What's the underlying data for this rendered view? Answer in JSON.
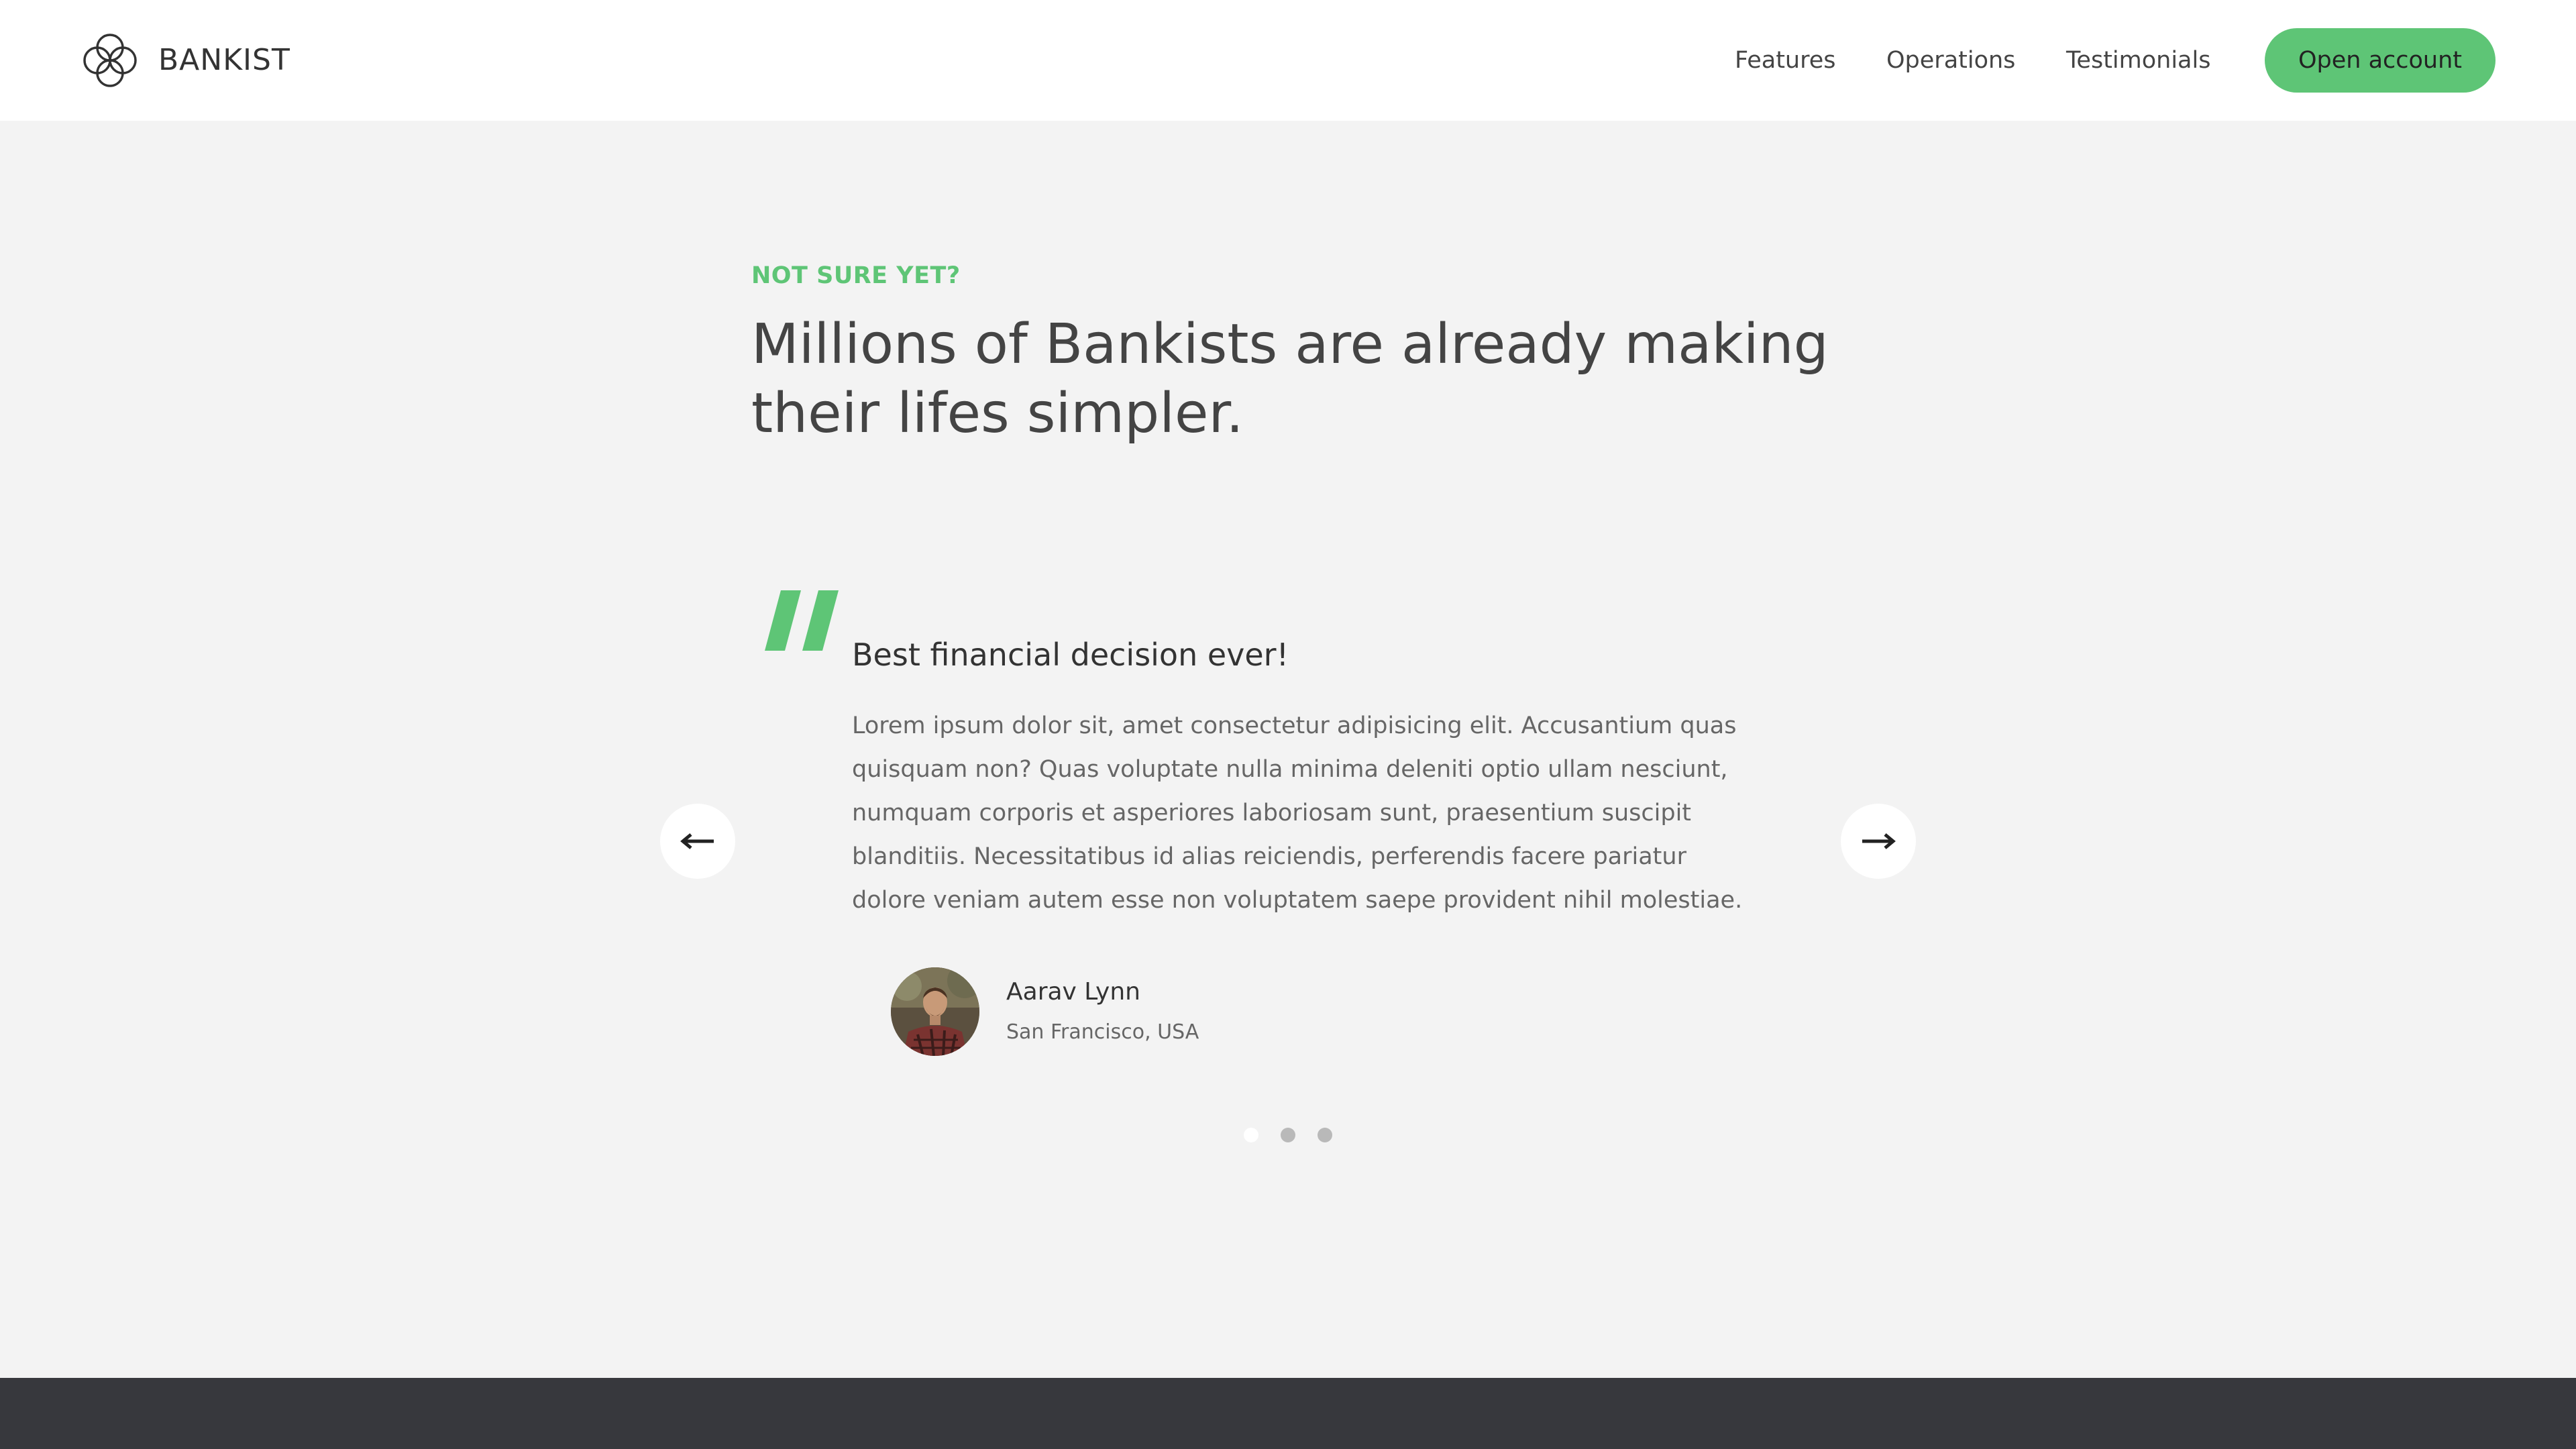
{
  "brand": {
    "name": "BANKIST",
    "logo_icon": "bankist-logo-icon"
  },
  "nav": {
    "links": [
      "Features",
      "Operations",
      "Testimonials"
    ],
    "cta": "Open account"
  },
  "section": {
    "label": "NOT SURE YET?",
    "heading": "Millions of Bankists are already making their lifes simpler."
  },
  "testimonial": {
    "quote_icon": "quote-mark-icon",
    "title": "Best financial decision ever!",
    "text": "Lorem ipsum dolor sit, amet consectetur adipisicing elit. Accusantium quas quisquam non? Quas voluptate nulla minima deleniti optio ullam nesciunt, numquam corporis et asperiores laboriosam sunt, praesentium suscipit blanditiis. Necessitatibus id alias reiciendis, perferendis facere pariatur dolore veniam autem esse non voluptatem saepe provident nihil molestiae.",
    "author": {
      "name": "Aarav Lynn",
      "location": "San Francisco, USA"
    }
  },
  "slider": {
    "prev_icon": "arrow-left-icon",
    "next_icon": "arrow-right-icon",
    "dot_count": 3,
    "active_dot": 1
  },
  "colors": {
    "accent": "#5ec576",
    "page_bg": "#f3f3f3",
    "nav_bg": "#ffffff",
    "footer_bg": "#37383d",
    "heading_text": "#444444"
  }
}
